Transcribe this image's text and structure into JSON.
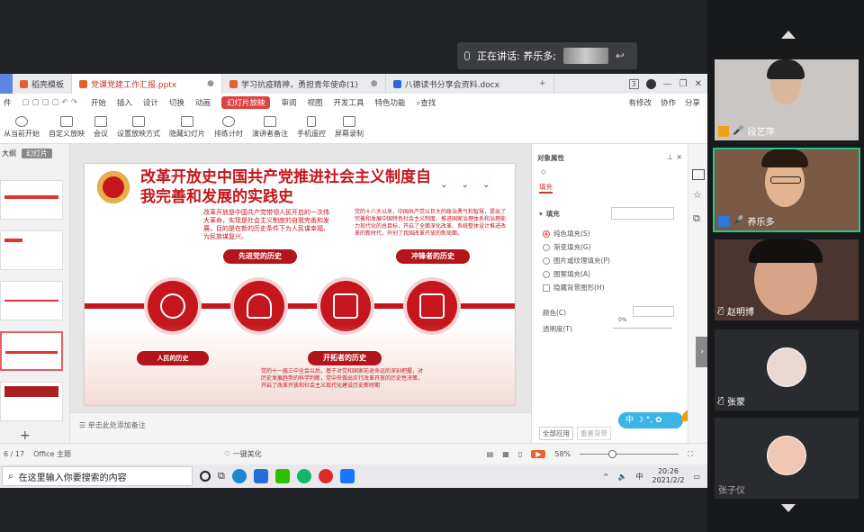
{
  "meeting": {
    "speaking_label": "正在讲话: 养乐多;"
  },
  "tabs": [
    {
      "label": "稻壳模板",
      "color": "#e8612c"
    },
    {
      "label": "党课党建工作汇报.pptx",
      "color": "#e8612c"
    },
    {
      "label": "学习抗疫精神，勇担青年使命(1)",
      "color": "#e8612c"
    },
    {
      "label": "八德读书分享会资料.docx",
      "color": "#2b6bd6"
    }
  ],
  "tabbar_badge": "3",
  "menu": {
    "file": "件",
    "items": [
      "开始",
      "插入",
      "设计",
      "切换",
      "动画",
      "幻灯片放映",
      "审阅",
      "视图",
      "开发工具",
      "特色功能"
    ],
    "active": "幻灯片放映",
    "search": "查找",
    "right": [
      "有修改",
      "协作",
      "分享"
    ]
  },
  "ribbon": [
    "从当前开始",
    "自定义放映",
    "会议",
    "设置放映方式",
    "隐藏幻灯片",
    "排练计时",
    "演讲者备注",
    "手机遥控",
    "屏幕录制"
  ],
  "leftpane": {
    "tab1": "大纲",
    "tab2": "幻灯片"
  },
  "slide": {
    "title": "改革开放史中国共产党推进社会主义制度自我完善和发展的实践史",
    "text1": "改革开放是中国共产党带领人民开启的一次伟大革命，实现是社会主义制度的自我完善和发展，目的是在新的历史条件下为人民谋幸福、为民族谋复兴。",
    "text2": "党的十八大以来，中国共产党以巨大的政治勇气和智慧，提出了完善和发展中国特色社会主义制度、推进国家治理体系和治理能力现代化的总目标，开启了全面深化改革、系统整体设计推进改革的新时代，开创了我国改革开放的新局面。",
    "text3": "党的十一届三中全会以后，基于对党和国家前途命运的深刻把握，对历史发展趋势的科学判断，党中央做出实行改革开放的历史性决策，开启了改革开放和社会主义现代化建设历史新时期",
    "pill1": "先进党的历史",
    "pill2": "冲锋者的历史",
    "pill3": "人民的历史",
    "pill4": "开拓者的历史",
    "notes": "单击此处添加备注"
  },
  "props": {
    "title": "对象属性",
    "tab": "填充",
    "section": "填充",
    "options": [
      "纯色填充(S)",
      "渐变填充(G)",
      "图片或纹理填充(P)",
      "图案填充(A)"
    ],
    "hide_bg": "隐藏背景图形(H)",
    "color_label": "颜色(C)",
    "transparency_label": "透明度(T)",
    "transparency_value": "0%",
    "apply_all": "全部应用",
    "reset_bg": "重置背景"
  },
  "status": {
    "page": "6 / 17",
    "theme": "Office 主题",
    "beautify": "一键美化",
    "zoom": "58%"
  },
  "taskbar": {
    "search_placeholder": "在这里输入你要搜索的内容",
    "time": "20:26",
    "date": "2021/2/2"
  },
  "participants": [
    {
      "name": "段艺萍",
      "mic": "on",
      "skin": "#d9b79d"
    },
    {
      "name": "养乐多",
      "mic": "on",
      "skin": "#e2b48f"
    },
    {
      "name": "赵明博",
      "mic": "off",
      "skin": "#d8a487"
    },
    {
      "name": "张蒙",
      "mic": "off",
      "skin": "#e9d9d0"
    },
    {
      "name": "张子仪",
      "mic": "none",
      "skin": "#f0c7b4"
    }
  ]
}
